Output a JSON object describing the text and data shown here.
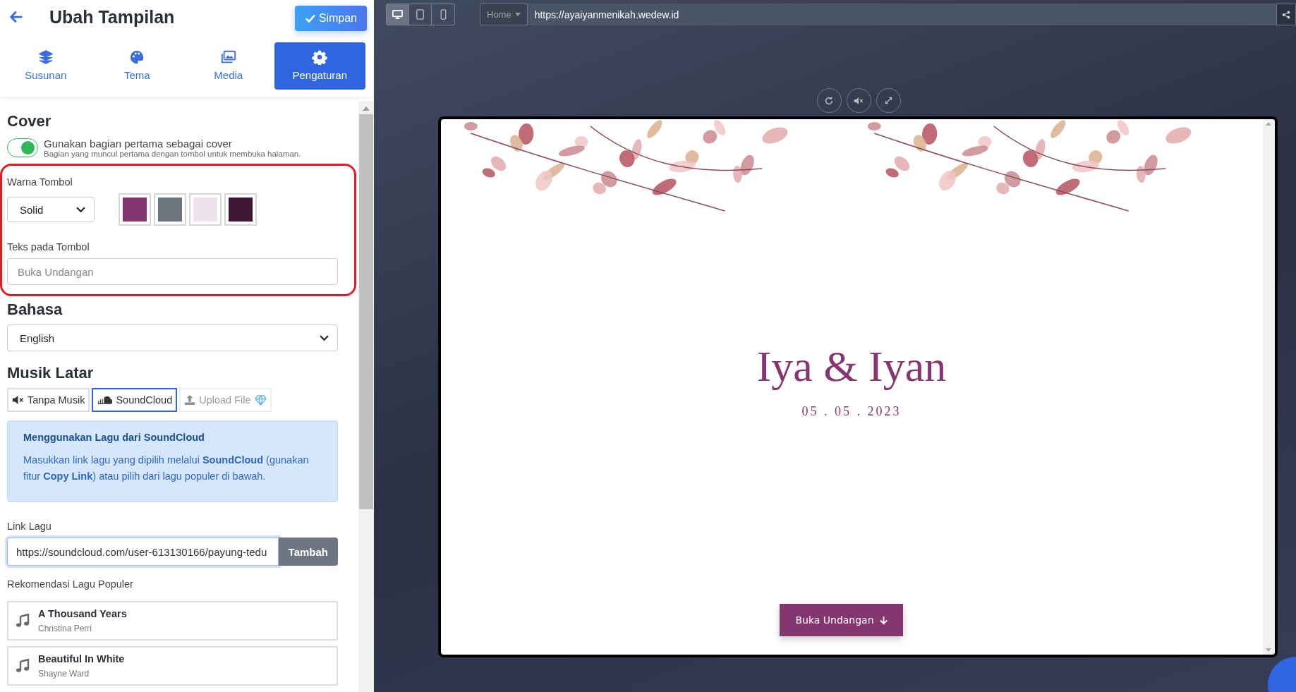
{
  "header": {
    "title": "Ubah Tampilan",
    "save_button": "Simpan"
  },
  "tabs": [
    {
      "label": "Susunan",
      "kind": "layers",
      "selected": false
    },
    {
      "label": "Tema",
      "kind": "palette",
      "selected": false
    },
    {
      "label": "Media",
      "kind": "images",
      "selected": false
    },
    {
      "label": "Pengaturan",
      "kind": "gear",
      "selected": true
    }
  ],
  "cover": {
    "heading": "Cover",
    "toggle": {
      "label": "Gunakan bagian pertama sebagai cover",
      "hint": "Bagian yang muncul pertama dengan tombol untuk membuka halaman.",
      "on": true
    },
    "button_color": {
      "label": "Warna Tombol",
      "style": "Solid",
      "swatches": [
        {
          "color": "#86366e"
        },
        {
          "color": "#6c757d"
        },
        {
          "color": "#efe3eb"
        },
        {
          "color": "#3f1533"
        }
      ]
    },
    "button_text": {
      "label": "Teks pada Tombol",
      "placeholder": "Buka Undangan"
    }
  },
  "language": {
    "heading": "Bahasa",
    "value": "English"
  },
  "music": {
    "heading": "Musik Latar",
    "options": [
      {
        "label": "Tanpa Musik",
        "kind": "mute",
        "selected": false,
        "disabled": false
      },
      {
        "label": "SoundCloud",
        "kind": "cloud",
        "selected": true,
        "disabled": false
      },
      {
        "label": "Upload File",
        "kind": "upload",
        "selected": false,
        "disabled": true
      }
    ],
    "info": {
      "title": "Menggunakan Lagu dari SoundCloud",
      "text": "Masukkan link lagu yang dipilih melalui **SoundCloud** (gunakan fitur **Copy Link**) atau pilih dari lagu populer di bawah."
    },
    "link": {
      "label": "Link Lagu",
      "value": "https://soundcloud.com/user-613130166/payung-tedu",
      "button": "Tambah"
    },
    "recommend_label": "Rekomendasi Lagu Populer",
    "songs": [
      {
        "title": "A Thousand Years",
        "artist": "Christina Perri"
      },
      {
        "title": "Beautiful In White",
        "artist": "Shayne Ward"
      }
    ]
  },
  "preview": {
    "devices": [
      {
        "kind": "desktop",
        "selected": true
      },
      {
        "kind": "tablet",
        "selected": false
      },
      {
        "kind": "phone",
        "selected": false
      }
    ],
    "page_menu": "Home",
    "url": "https://ayaiyanmenikah.wedew.id",
    "controls": [
      {
        "kind": "reload"
      },
      {
        "kind": "mute"
      },
      {
        "kind": "expand"
      }
    ],
    "names": "Iya & Iyan",
    "date": "05 . 05 . 2023",
    "open_button": "Buka Undangan"
  }
}
